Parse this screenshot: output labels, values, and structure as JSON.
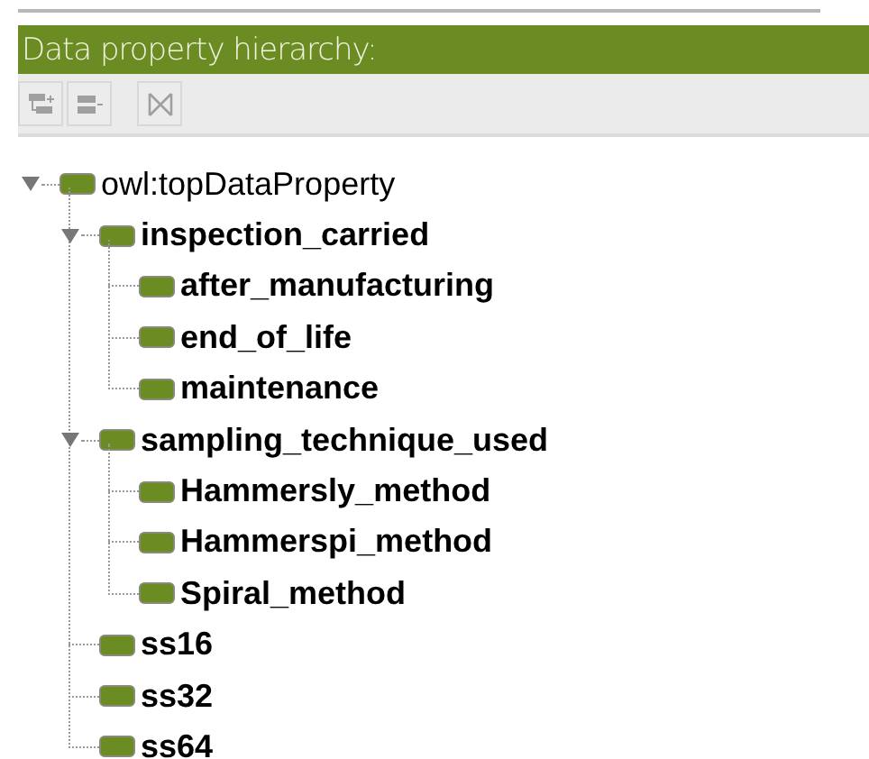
{
  "panel": {
    "title": "Data property hierarchy:"
  },
  "toolbar": [
    {
      "kind": "add_sub",
      "disabled": true
    },
    {
      "kind": "add_sibling",
      "disabled": true
    },
    {
      "kind": "delete",
      "disabled": true
    }
  ],
  "tree": [
    {
      "label": "owl:topDataProperty",
      "expanded": true,
      "children": [
        {
          "label": "inspection_carried",
          "expanded": true,
          "children": [
            {
              "label": "after_manufacturing"
            },
            {
              "label": "end_of_life"
            },
            {
              "label": "maintenance"
            }
          ]
        },
        {
          "label": "sampling_technique_used",
          "expanded": true,
          "children": [
            {
              "label": "Hammersly_method"
            },
            {
              "label": "Hammerspi_method"
            },
            {
              "label": "Spiral_method"
            }
          ]
        },
        {
          "label": "ss16"
        },
        {
          "label": "ss32"
        },
        {
          "label": "ss64"
        }
      ]
    }
  ]
}
